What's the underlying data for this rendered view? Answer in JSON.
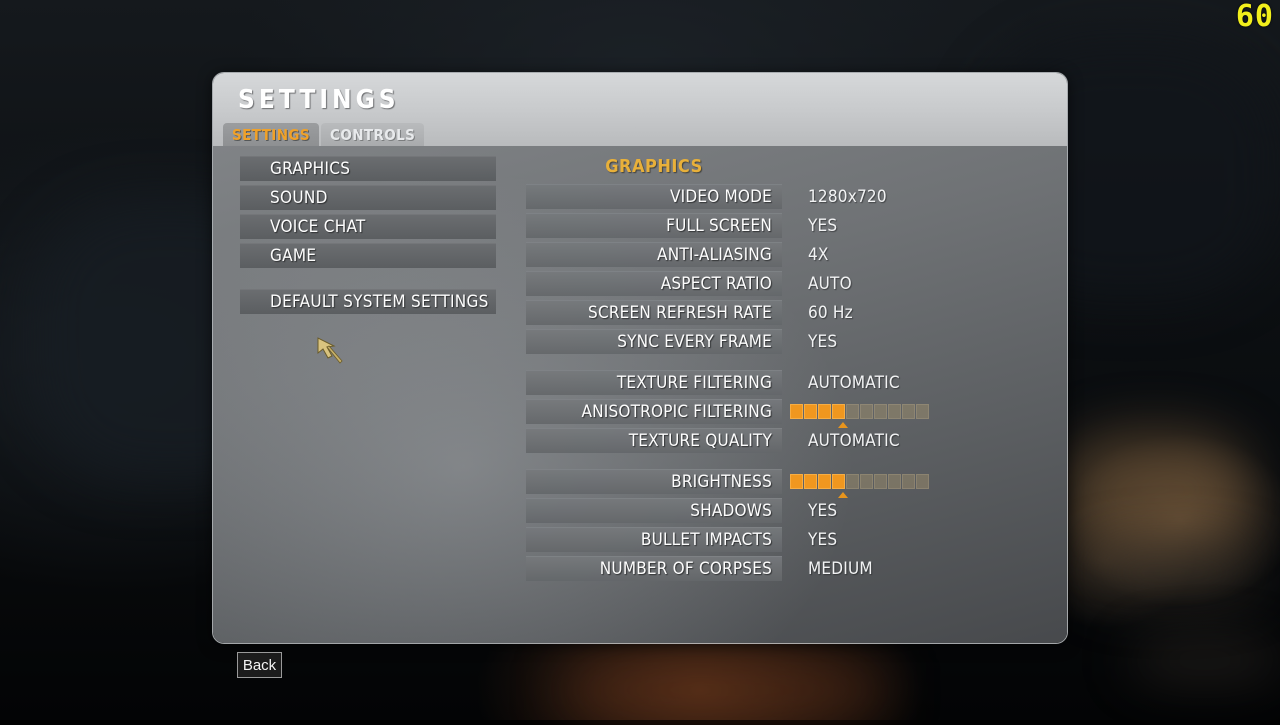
{
  "hud": {
    "fps_counter": "60"
  },
  "panel": {
    "title": "SETTINGS",
    "tabs": [
      {
        "label": "SETTINGS",
        "active": true
      },
      {
        "label": "CONTROLS",
        "active": false
      }
    ]
  },
  "sidebar": {
    "items": [
      {
        "label": "GRAPHICS"
      },
      {
        "label": "SOUND"
      },
      {
        "label": "VOICE CHAT"
      },
      {
        "label": "GAME"
      }
    ],
    "default_button": "DEFAULT SYSTEM SETTINGS"
  },
  "settings": {
    "section_title": "GRAPHICS",
    "groups": [
      {
        "rows": [
          {
            "label": "VIDEO MODE",
            "value": "1280x720",
            "type": "value"
          },
          {
            "label": "FULL SCREEN",
            "value": "YES",
            "type": "value"
          },
          {
            "label": "ANTI-ALIASING",
            "value": "4X",
            "type": "value"
          },
          {
            "label": "ASPECT RATIO",
            "value": "AUTO",
            "type": "value"
          },
          {
            "label": "SCREEN REFRESH RATE",
            "value": "60 Hz",
            "type": "value"
          },
          {
            "label": "SYNC EVERY FRAME",
            "value": "YES",
            "type": "value"
          }
        ]
      },
      {
        "rows": [
          {
            "label": "TEXTURE FILTERING",
            "value": "AUTOMATIC",
            "type": "value"
          },
          {
            "label": "ANISOTROPIC FILTERING",
            "value": "",
            "type": "slider",
            "segments": 10,
            "filled": 4
          },
          {
            "label": "TEXTURE QUALITY",
            "value": "AUTOMATIC",
            "type": "value"
          }
        ]
      },
      {
        "rows": [
          {
            "label": "BRIGHTNESS",
            "value": "",
            "type": "slider",
            "segments": 10,
            "filled": 4
          },
          {
            "label": "SHADOWS",
            "value": "YES",
            "type": "value"
          },
          {
            "label": "BULLET IMPACTS",
            "value": "YES",
            "type": "value"
          },
          {
            "label": "NUMBER OF CORPSES",
            "value": "MEDIUM",
            "type": "value"
          }
        ]
      }
    ]
  },
  "footer": {
    "back_label": "Back"
  },
  "colors": {
    "accent_orange": "#f0a128",
    "section_title": "#e8b03a",
    "slider_on": "#f0971f",
    "fps_yellow": "#f2ef1c"
  },
  "cursor": {
    "icon": "arrow-cursor-icon"
  }
}
